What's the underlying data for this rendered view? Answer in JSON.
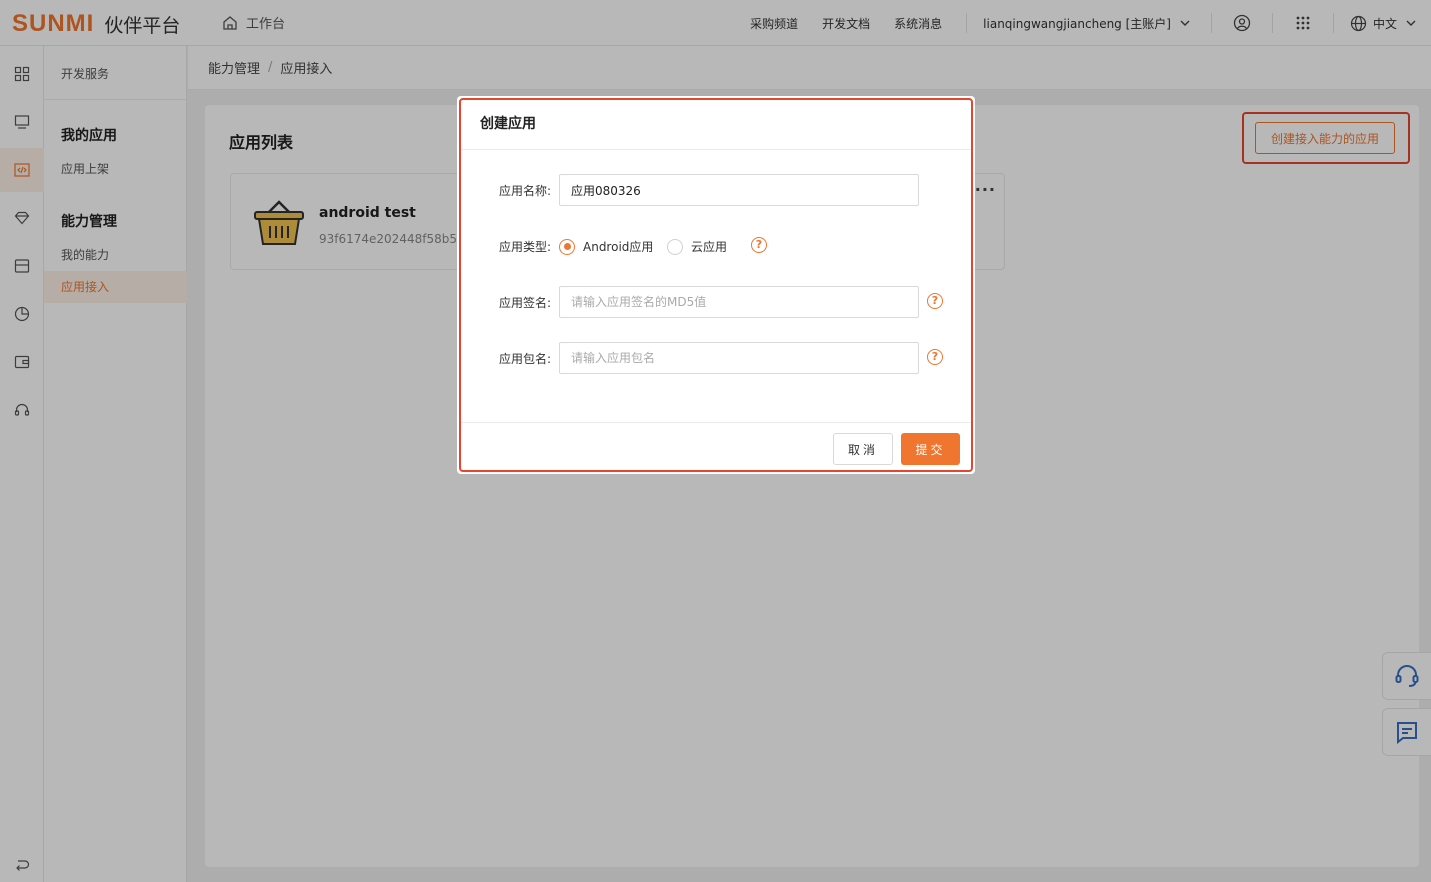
{
  "header": {
    "logo_mark": "SUNMI",
    "logo_text": "伙伴平台",
    "workbench": "工作台",
    "nav": [
      "采购频道",
      "开发文档",
      "系统消息"
    ],
    "account": "lianqingwangjiancheng [主账户]",
    "language": "中文"
  },
  "sidebar": {
    "head": "开发服务",
    "groups": [
      {
        "title": "我的应用",
        "items": [
          "应用上架"
        ]
      },
      {
        "title": "能力管理",
        "items": [
          "我的能力",
          "应用接入"
        ]
      }
    ]
  },
  "breadcrumb": {
    "parent": "能力管理",
    "sep": "/",
    "current": "应用接入"
  },
  "main": {
    "page_title": "应用列表",
    "create_button": "创建接入能力的应用",
    "app_card": {
      "name": "android test",
      "id": "93f6174e202448f58b5",
      "more": "···"
    }
  },
  "modal": {
    "title": "创建应用",
    "fields": {
      "name_label": "应用名称:",
      "name_value": "应用080326",
      "type_label": "应用类型:",
      "type_options": [
        "Android应用",
        "云应用"
      ],
      "type_selected": "Android应用",
      "sign_label": "应用签名:",
      "sign_placeholder": "请输入应用签名的MD5值",
      "package_label": "应用包名:",
      "package_placeholder": "请输入应用包名"
    },
    "help_glyph": "?",
    "cancel": "取消",
    "submit": "提交"
  },
  "colors": {
    "accent": "#f0752e",
    "highlight": "#e8452f"
  }
}
